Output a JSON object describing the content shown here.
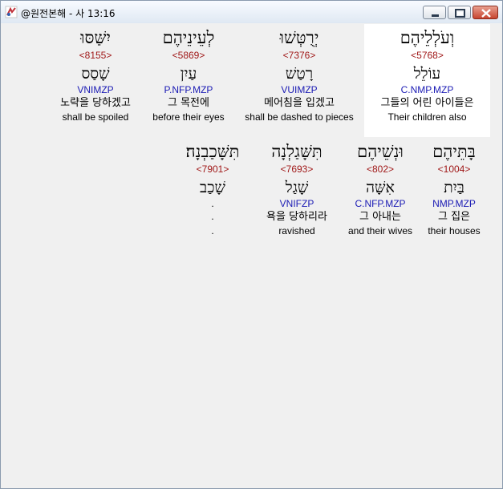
{
  "window": {
    "title": "@원전본해 - 사 13:16"
  },
  "colors": {
    "strong": "#a01818",
    "morph": "#1a1ab4",
    "selected_background": "#ffffff"
  },
  "words": [
    {
      "hebrew": "וְעֹלְלֵיהֶם",
      "strong": "<5768>",
      "lemma": "עוֹלֵל",
      "morph": "C.NMP.MZP",
      "korean": "그들의 어린 아이들은",
      "english": "Their children also"
    },
    {
      "hebrew": "יְרֻטְּשׁוּ",
      "strong": "<7376>",
      "lemma": "רָטַשׁ",
      "morph": "VUIMZP",
      "korean": "메어침을 입겠고",
      "english": "shall be dashed to pieces"
    },
    {
      "hebrew": "לְעֵינֵיהֶם",
      "strong": "<5869>",
      "lemma": "עַיִן",
      "morph": "P.NFP.MZP",
      "korean": "그 목전에",
      "english": "before their eyes"
    },
    {
      "hebrew": "יִשַּׁסּוּ",
      "strong": "<8155>",
      "lemma": "שָׁסַס",
      "morph": "VNIMZP",
      "korean": "노략을 당하겠고",
      "english": "shall be spoiled"
    },
    {
      "hebrew": "בָּתֵּיהֶם",
      "strong": "<1004>",
      "lemma": "בַּיִת",
      "morph": "NMP.MZP",
      "korean": "그 집은",
      "english": "their houses"
    },
    {
      "hebrew": "וּנְשֵׁיהֶם",
      "strong": "<802>",
      "lemma": "אִשָּׁה",
      "morph": "C.NFP.MZP",
      "korean": "그 아내는",
      "english": "and their wives"
    },
    {
      "hebrew": "תִּשָּׁגַלְנָה",
      "strong": "<7693>",
      "lemma": "שָׁגַל",
      "morph": "VNIFZP",
      "korean": "욕을 당하리라",
      "english": "ravished"
    },
    {
      "hebrew": "תִּשָּׁכַבְנָה׃",
      "strong": "<7901>",
      "lemma": "שָׁכַב",
      "morph": ".",
      "korean": ".",
      "english": "."
    }
  ]
}
